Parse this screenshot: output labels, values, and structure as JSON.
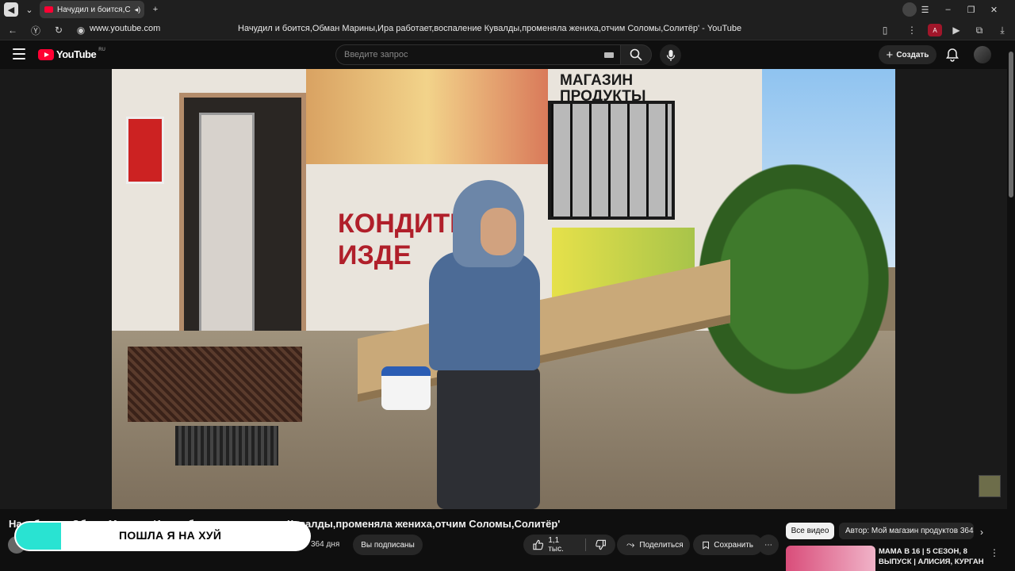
{
  "browser": {
    "tab_title": "Начудил и боится,С",
    "url": "www.youtube.com",
    "page_title": "Начудил и боится,Обман Марины,Ира работает,воспаление Кувалды,променяла жениха,отчим Соломы,Солитёр' - YouTube",
    "window_controls": [
      "☰",
      "–",
      "❐",
      "✕"
    ]
  },
  "header": {
    "logo_text": "YouTube",
    "logo_region": "RU",
    "search_placeholder": "Введите запрос",
    "create_label": "Создать"
  },
  "video": {
    "scene_shop_sign": "МАГАЗИН\nПРОДУКТЫ",
    "scene_mural_text": "КОНДИТЕР\nИЗДЕ"
  },
  "below_player": {
    "title": "На... боится,Обман Марины,Ира работает,воспаление Кувалды,променяла жениха,отчим Соломы,Солитёр'",
    "days_ago": "364 дня",
    "subscribed_label": "Вы подписаны",
    "likes": "1,1 тыс.",
    "share_label": "Поделиться",
    "save_label": "Сохранить",
    "more_label": "⋯"
  },
  "overlay": {
    "text": "ПОШЛА Я НА ХУЙ"
  },
  "sidebar": {
    "chip_all": "Все видео",
    "chip_author": "Автор: Мой магазин продуктов 364",
    "chip_next": "›",
    "rec_title": "МАМА В 16 | 5 СЕЗОН, 8 ВЫПУСК | АЛИСИЯ, КУРГАН",
    "rec_more": "⋮"
  },
  "colors": {
    "accent": "#ff0033",
    "overlay_bar": "#29e3d2",
    "background": "#0f0f0f"
  }
}
